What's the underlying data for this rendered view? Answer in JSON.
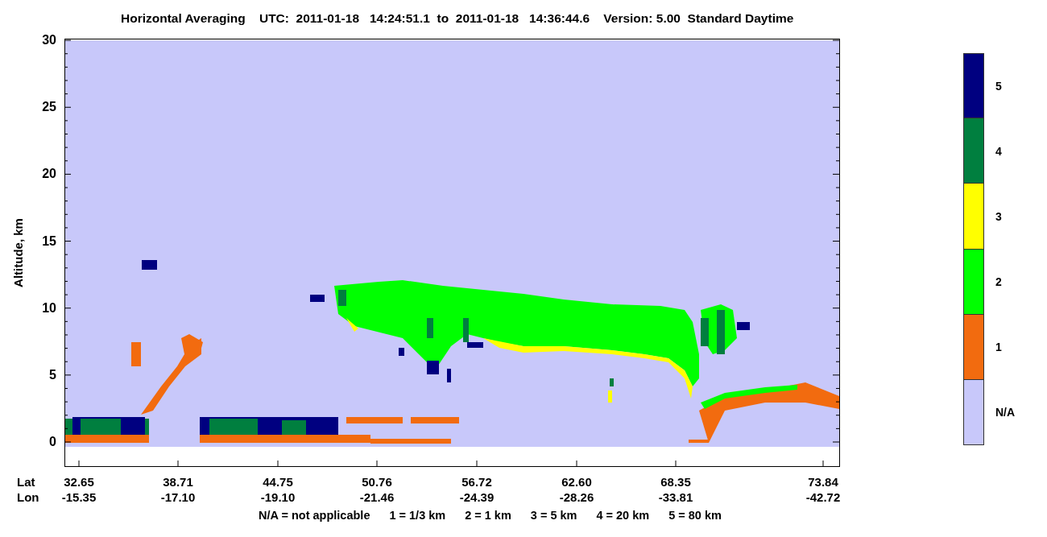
{
  "title": "Horizontal Averaging    UTC:  2011-01-18   14:24:51.1  to  2011-01-18   14:36:44.6    Version: 5.00  Standard Daytime",
  "y_axis": {
    "label": "Altitude, km",
    "ticks": [
      "30",
      "25",
      "20",
      "15",
      "10",
      "5",
      "0"
    ]
  },
  "x_axis": {
    "rows": [
      {
        "label": "Lat",
        "values": [
          "32.65",
          "38.71",
          "44.75",
          "50.76",
          "56.72",
          "62.60",
          "68.35",
          "73.84"
        ]
      },
      {
        "label": "Lon",
        "values": [
          "-15.35",
          "-17.10",
          "-19.10",
          "-21.46",
          "-24.39",
          "-28.26",
          "-33.81",
          "-42.72"
        ]
      }
    ]
  },
  "colorbar": {
    "entries": [
      {
        "label": "5",
        "color": "#000080"
      },
      {
        "label": "4",
        "color": "#007f3f"
      },
      {
        "label": "3",
        "color": "#ffff00"
      },
      {
        "label": "2",
        "color": "#00ff00"
      },
      {
        "label": "1",
        "color": "#f26b0f"
      },
      {
        "label": "N/A",
        "color": "#c8c8fa"
      }
    ]
  },
  "legend": [
    "N/A = not applicable",
    "1 = 1/3 km",
    "2 = 1 km",
    "3 = 5 km",
    "4 = 20 km",
    "5 = 80 km"
  ]
}
